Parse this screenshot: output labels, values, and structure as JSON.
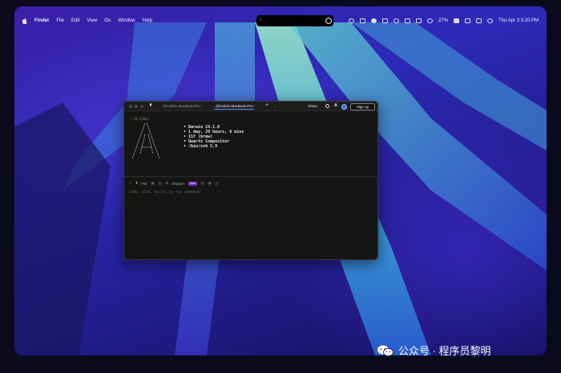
{
  "menubar": {
    "items": [
      "Finder",
      "File",
      "Edit",
      "View",
      "Go",
      "Window",
      "Help"
    ],
    "battery": "27%",
    "datetime": "Thu Apr 3  3:20 PM"
  },
  "terminal": {
    "tabs": [
      "..@Andrés-MacBook-Pro~",
      "..@Andrés-MacBook-Pro~"
    ],
    "share_label": "Share",
    "a_label": "A",
    "signup_label": "Sign up",
    "timing": "~ (0.136s)",
    "sysinfo": [
      "Darwin 24.1.0",
      "1 day, 20 hours, 6 mins",
      "157 (brew)",
      "Quartz Compositor",
      "/bin/zsh 5.9"
    ],
    "input_mode": "Pair",
    "dispatch_label": "Dispatch",
    "beta_label": "Beta",
    "prompt_placeholder": "Code, plan, build, or run commands"
  },
  "watermark": {
    "text": "公众号 · 程序员黎明"
  },
  "colors": {
    "accent": "#5a8bff",
    "beta_badge": "#7a2fb5",
    "wallpaper_base": "#2c2ab8"
  }
}
